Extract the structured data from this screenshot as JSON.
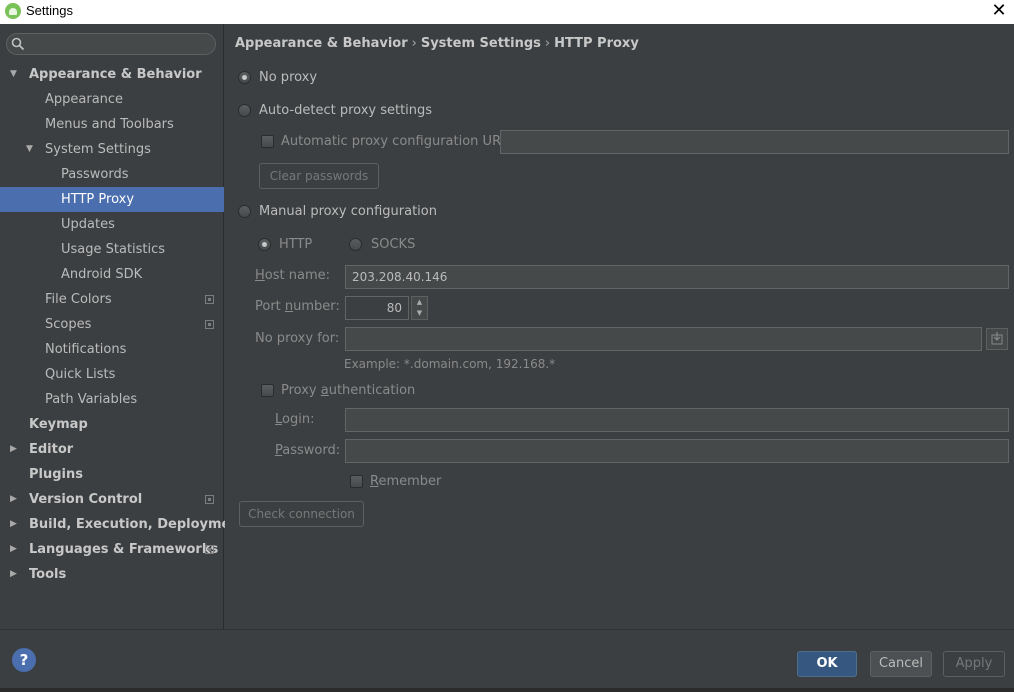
{
  "window": {
    "title": "Settings"
  },
  "search": {
    "placeholder": ""
  },
  "tree": [
    {
      "label": "Appearance & Behavior",
      "level": 0,
      "expanded": true,
      "bold": true
    },
    {
      "label": "Appearance",
      "level": 1
    },
    {
      "label": "Menus and Toolbars",
      "level": 1
    },
    {
      "label": "System Settings",
      "level": 1,
      "expanded": true
    },
    {
      "label": "Passwords",
      "level": 2
    },
    {
      "label": "HTTP Proxy",
      "level": 2,
      "selected": true
    },
    {
      "label": "Updates",
      "level": 2
    },
    {
      "label": "Usage Statistics",
      "level": 2
    },
    {
      "label": "Android SDK",
      "level": 2
    },
    {
      "label": "File Colors",
      "level": 1,
      "project": true
    },
    {
      "label": "Scopes",
      "level": 1,
      "project": true
    },
    {
      "label": "Notifications",
      "level": 1
    },
    {
      "label": "Quick Lists",
      "level": 1
    },
    {
      "label": "Path Variables",
      "level": 1
    },
    {
      "label": "Keymap",
      "level": 0,
      "bold": true
    },
    {
      "label": "Editor",
      "level": 0,
      "bold": true,
      "collapsed": true
    },
    {
      "label": "Plugins",
      "level": 0,
      "bold": true
    },
    {
      "label": "Version Control",
      "level": 0,
      "bold": true,
      "collapsed": true,
      "project": true
    },
    {
      "label": "Build, Execution, Deployment",
      "level": 0,
      "bold": true,
      "collapsed": true
    },
    {
      "label": "Languages & Frameworks",
      "level": 0,
      "bold": true,
      "collapsed": true,
      "project": true
    },
    {
      "label": "Tools",
      "level": 0,
      "bold": true,
      "collapsed": true
    }
  ],
  "breadcrumb": [
    "Appearance & Behavior",
    "System Settings",
    "HTTP Proxy"
  ],
  "proxy": {
    "no_proxy": "No proxy",
    "auto_detect": "Auto-detect proxy settings",
    "auto_url_label": "Automatic proxy configuration URL:",
    "auto_url_value": "",
    "clear_passwords": "Clear passwords",
    "manual": "Manual proxy configuration",
    "http": "HTTP",
    "socks": "SOCKS",
    "host_label_u": "H",
    "host_label_rest": "ost name:",
    "host_value": "203.208.40.146",
    "port_label_pre": "Port ",
    "port_label_u": "n",
    "port_label_rest": "umber:",
    "port_value": "80",
    "no_proxy_for_label": "No proxy for:",
    "no_proxy_for_value": "",
    "example": "Example: *.domain.com, 192.168.*",
    "auth_pre": "Proxy ",
    "auth_u": "a",
    "auth_rest": "uthentication",
    "login_u": "L",
    "login_rest": "ogin:",
    "login_value": "",
    "password_u": "P",
    "password_rest": "assword:",
    "password_value": "",
    "remember_u": "R",
    "remember_rest": "emember",
    "check_connection": "Check connection"
  },
  "footer": {
    "help": "?",
    "ok": "OK",
    "cancel": "Cancel",
    "apply": "Apply"
  },
  "colors": {
    "selection": "#4b6eaf",
    "background": "#3c3f41",
    "ok_button": "#365880"
  }
}
